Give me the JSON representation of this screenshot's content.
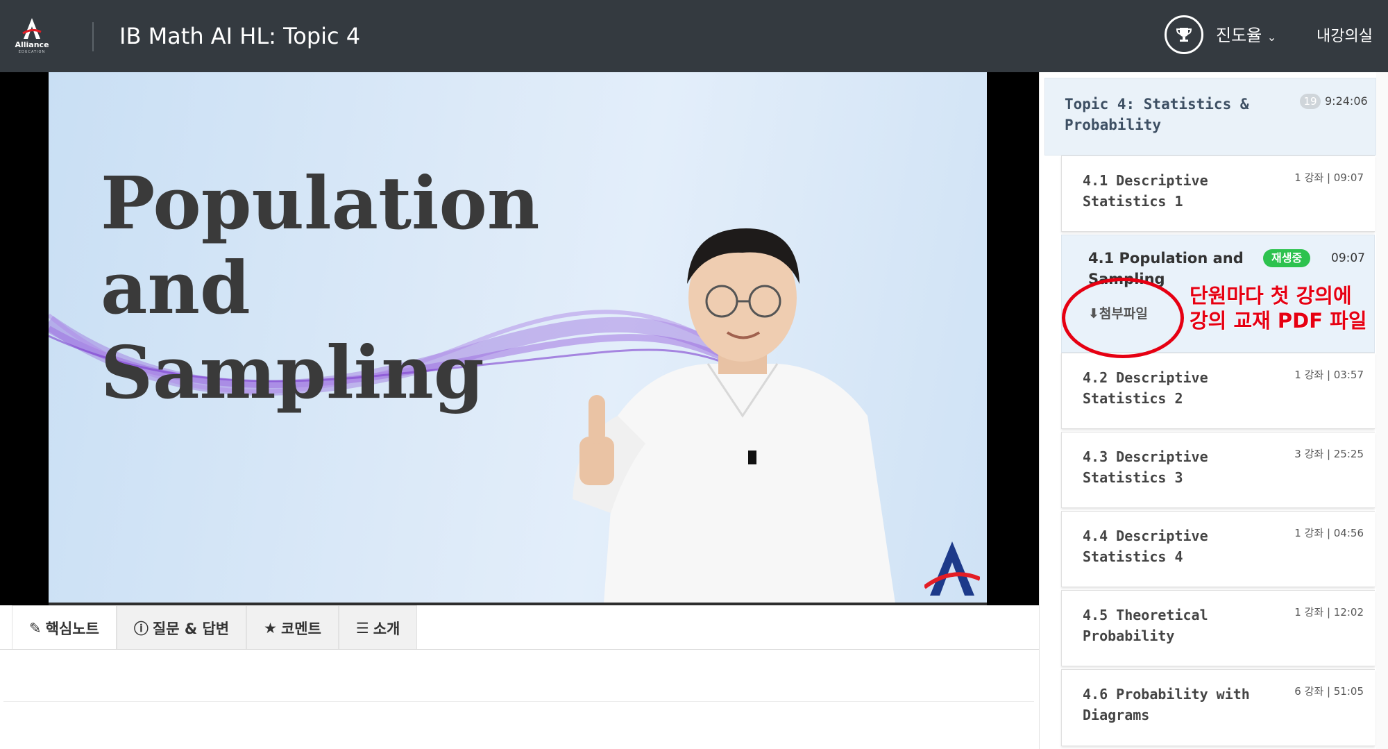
{
  "header": {
    "logo_text": "Alliance",
    "logo_subtext": "EDUCATION",
    "course_title": "IB Math AI HL: Topic 4",
    "progress_label": "진도율",
    "my_classroom": "내강의실"
  },
  "video": {
    "slide_title": "Population and\nSampling",
    "toolbar_icons": [
      "arrow-left-icon",
      "windows-icon",
      "square-icon",
      "pen-icon",
      "close-icon"
    ]
  },
  "tabs": [
    {
      "label": "핵심노트",
      "icon": "edit-icon",
      "active": true
    },
    {
      "label": "질문 & 답변",
      "icon": "info-icon",
      "active": false
    },
    {
      "label": "코멘트",
      "icon": "star-icon",
      "active": false
    },
    {
      "label": "소개",
      "icon": "list-icon",
      "active": false
    }
  ],
  "sidebar": {
    "topic": {
      "title": "Topic 4: Statistics & Probability",
      "count": "19",
      "duration": "9:24:06"
    },
    "lectures": [
      {
        "title": "4.1 Descriptive Statistics 1",
        "meta": "1 강좌 | 09:07"
      },
      {
        "title": "4.2 Descriptive Statistics 2",
        "meta": "1 강좌 | 03:57"
      },
      {
        "title": "4.3 Descriptive Statistics 3",
        "meta": "3 강좌 | 25:25"
      },
      {
        "title": "4.4 Descriptive Statistics 4",
        "meta": "1 강좌 | 04:56"
      },
      {
        "title": "4.5 Theoretical Probability",
        "meta": "1 강좌 | 12:02"
      },
      {
        "title": "4.6 Probability with Diagrams",
        "meta": "6 강좌 | 51:05"
      }
    ],
    "current": {
      "title": "4.1 Population and Sampling",
      "badge": "재생중",
      "duration": "09:07",
      "attachment": "첨부파일"
    }
  },
  "annotation": {
    "text": "단원마다 첫 강의에\n강의 교재 PDF 파일"
  },
  "colors": {
    "header_bg": "#343a40",
    "badge_green": "#2dc24e",
    "annotation_red": "#e60012",
    "topic_bg": "#eaf2f9"
  }
}
